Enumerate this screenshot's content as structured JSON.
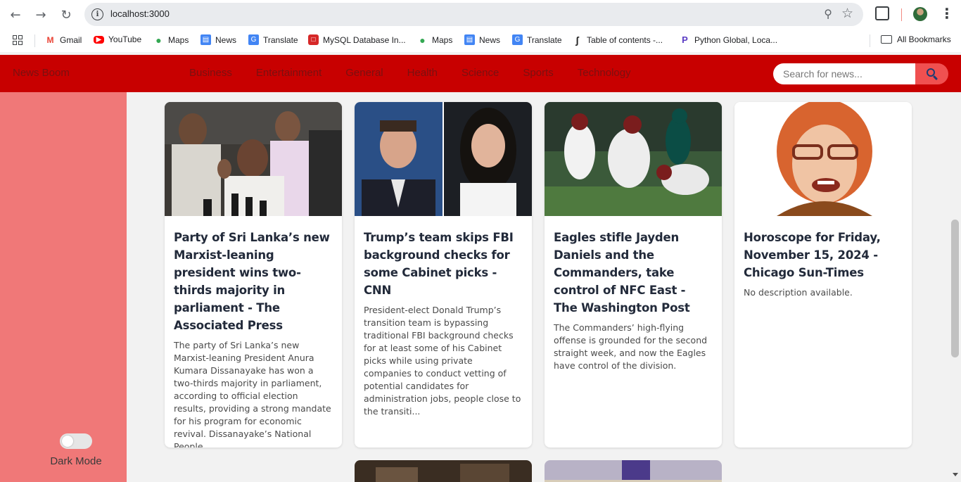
{
  "browser": {
    "url": "localhost:3000",
    "bookmarks": [
      {
        "label": "Gmail",
        "icon": "gmail-icon",
        "color": "#ea4335"
      },
      {
        "label": "YouTube",
        "icon": "youtube-icon",
        "color": "#ff0000"
      },
      {
        "label": "Maps",
        "icon": "maps-icon",
        "color": "#34a853"
      },
      {
        "label": "News",
        "icon": "news-icon",
        "color": "#4285f4"
      },
      {
        "label": "Translate",
        "icon": "translate-icon",
        "color": "#4285f4"
      },
      {
        "label": "MySQL Database In...",
        "icon": "mysql-icon",
        "color": "#d62828"
      },
      {
        "label": "Maps",
        "icon": "maps-icon",
        "color": "#34a853"
      },
      {
        "label": "News",
        "icon": "news-icon",
        "color": "#4285f4"
      },
      {
        "label": "Translate",
        "icon": "translate-icon",
        "color": "#4285f4"
      },
      {
        "label": "Table of contents -...",
        "icon": "ship-icon",
        "color": "#222222"
      },
      {
        "label": "Python Global, Loca...",
        "icon": "python-icon",
        "color": "#5b3cc4"
      }
    ],
    "all_bookmarks": "All Bookmarks"
  },
  "app": {
    "brand": "News Boom",
    "categories": [
      "Business",
      "Entertainment",
      "General",
      "Health",
      "Science",
      "Sports",
      "Technology"
    ],
    "search_placeholder": "Search for news...",
    "dark_mode_label": "Dark Mode",
    "colors": {
      "navbar": "#c80000",
      "sidebar": "#f07878",
      "search_button": "#f05050"
    }
  },
  "articles": [
    {
      "title": "Party of Sri Lanka’s new Marxist-leaning president wins two-thirds majority in parliament - The Associated Press",
      "description": "The party of Sri Lanka’s new Marxist-leaning President Anura Kumara Dissanayake has won a two-thirds majority in parliament, according to official election results, providing a strong mandate for his program for economic revival. Dissanayake’s National People..."
    },
    {
      "title": "Trump’s team skips FBI background checks for some Cabinet picks - CNN",
      "description": "President-elect Donald Trump’s transition team is bypassing traditional FBI background checks for at least some of his Cabinet picks while using private companies to conduct vetting of potential candidates for administration jobs, people close to the transiti..."
    },
    {
      "title": "Eagles stifle Jayden Daniels and the Commanders, take control of NFC East - The Washington Post",
      "description": "The Commanders’ high-flying offense is grounded for the second straight week, and now the Eagles have control of the division."
    },
    {
      "title": "Horoscope for Friday, November 15, 2024 - Chicago Sun-Times",
      "description": "No description available."
    }
  ]
}
